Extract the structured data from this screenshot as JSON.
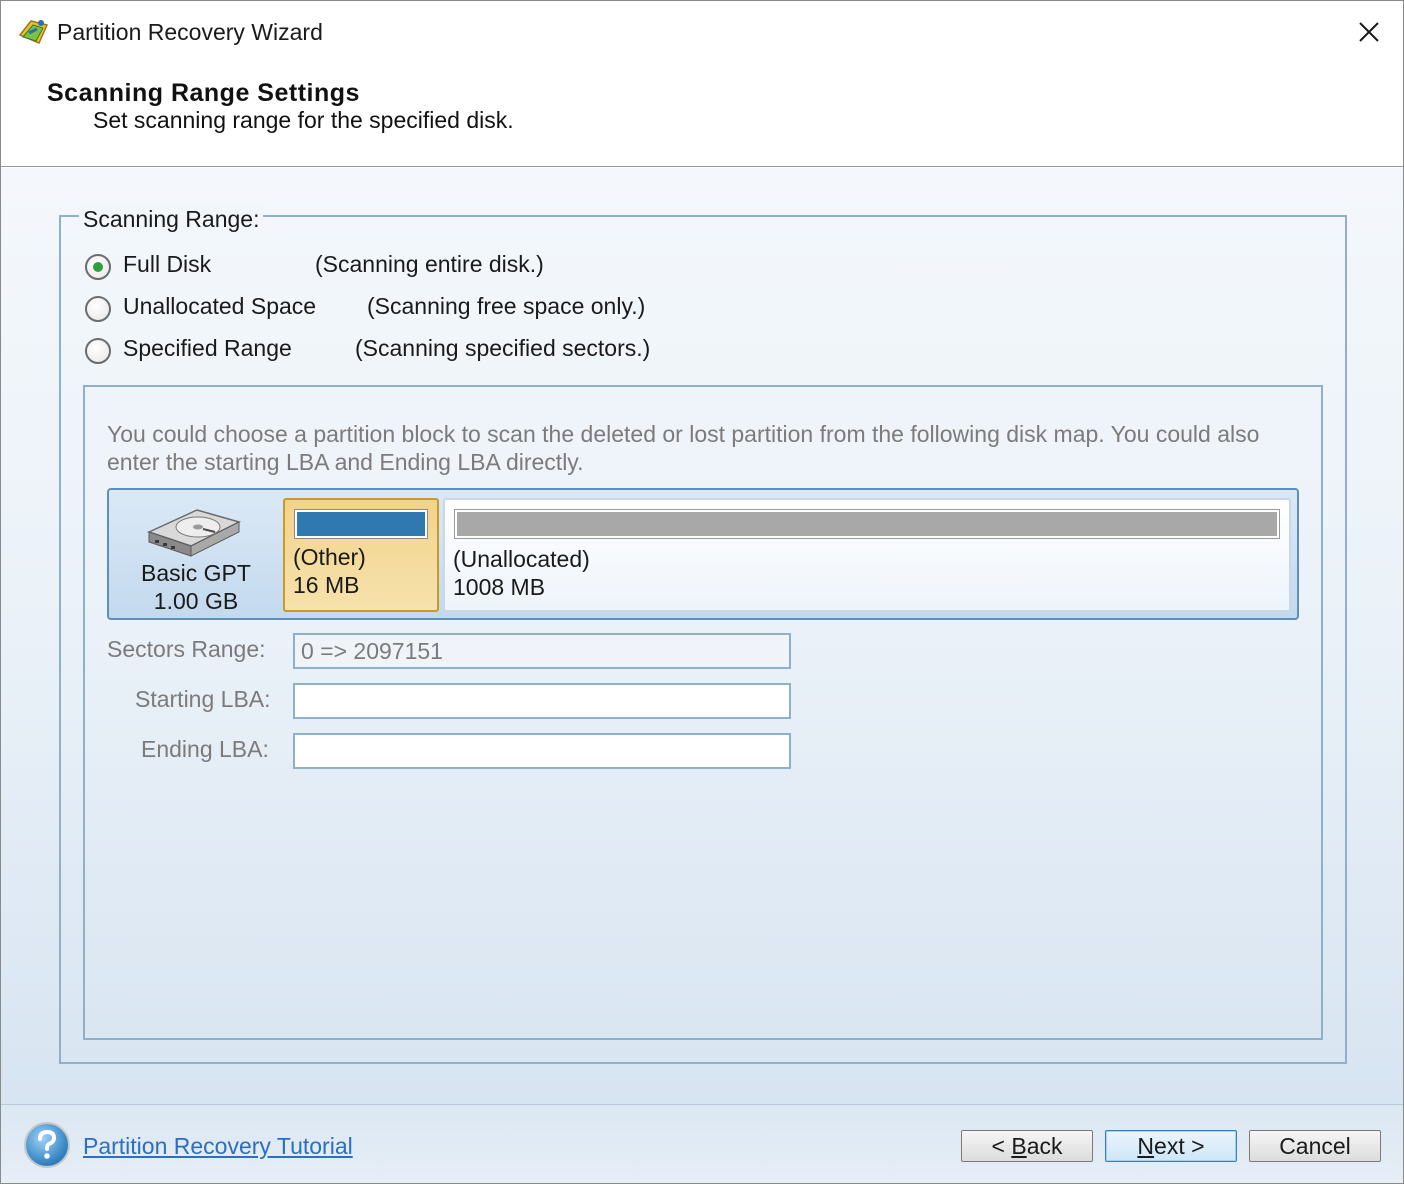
{
  "window": {
    "title": "Partition Recovery Wizard"
  },
  "header": {
    "title": "Scanning Range Settings",
    "subtitle": "Set scanning range for the specified disk."
  },
  "scanning_range": {
    "legend": "Scanning Range:",
    "options": [
      {
        "label": "Full Disk",
        "description": "(Scanning entire disk.)",
        "checked": true
      },
      {
        "label": "Unallocated Space",
        "description": "(Scanning free space only.)",
        "checked": false
      },
      {
        "label": "Specified Range",
        "description": "(Scanning specified sectors.)",
        "checked": false
      }
    ]
  },
  "info_text": "You could choose a partition block to scan the deleted or lost partition from the following disk map. You could also enter the starting LBA and Ending LBA directly.",
  "disk_map": {
    "disk": {
      "name": "Basic GPT",
      "size": "1.00 GB"
    },
    "partitions": [
      {
        "label": "(Other)",
        "size": "16 MB",
        "color": "#2f78b0",
        "selected": true
      },
      {
        "label": "(Unallocated)",
        "size": "1008 MB",
        "color": "#a8a8a8",
        "selected": false
      }
    ]
  },
  "fields": {
    "sectors_range_label": "Sectors Range:",
    "sectors_range_value": "0 => 2097151",
    "starting_lba_label": "Starting LBA:",
    "starting_lba_value": "",
    "ending_lba_label": "Ending LBA:",
    "ending_lba_value": ""
  },
  "footer": {
    "tutorial_link": "Partition Recovery Tutorial",
    "back_prefix": "< ",
    "back_mnemonic": "B",
    "back_rest": "ack",
    "next_mnemonic": "N",
    "next_rest": "ext >",
    "cancel": "Cancel"
  },
  "colors": {
    "accent_link": "#2a6fc0",
    "selected_partition_bg": "#f3d38a",
    "radio_checked": "#2e9e3e"
  }
}
